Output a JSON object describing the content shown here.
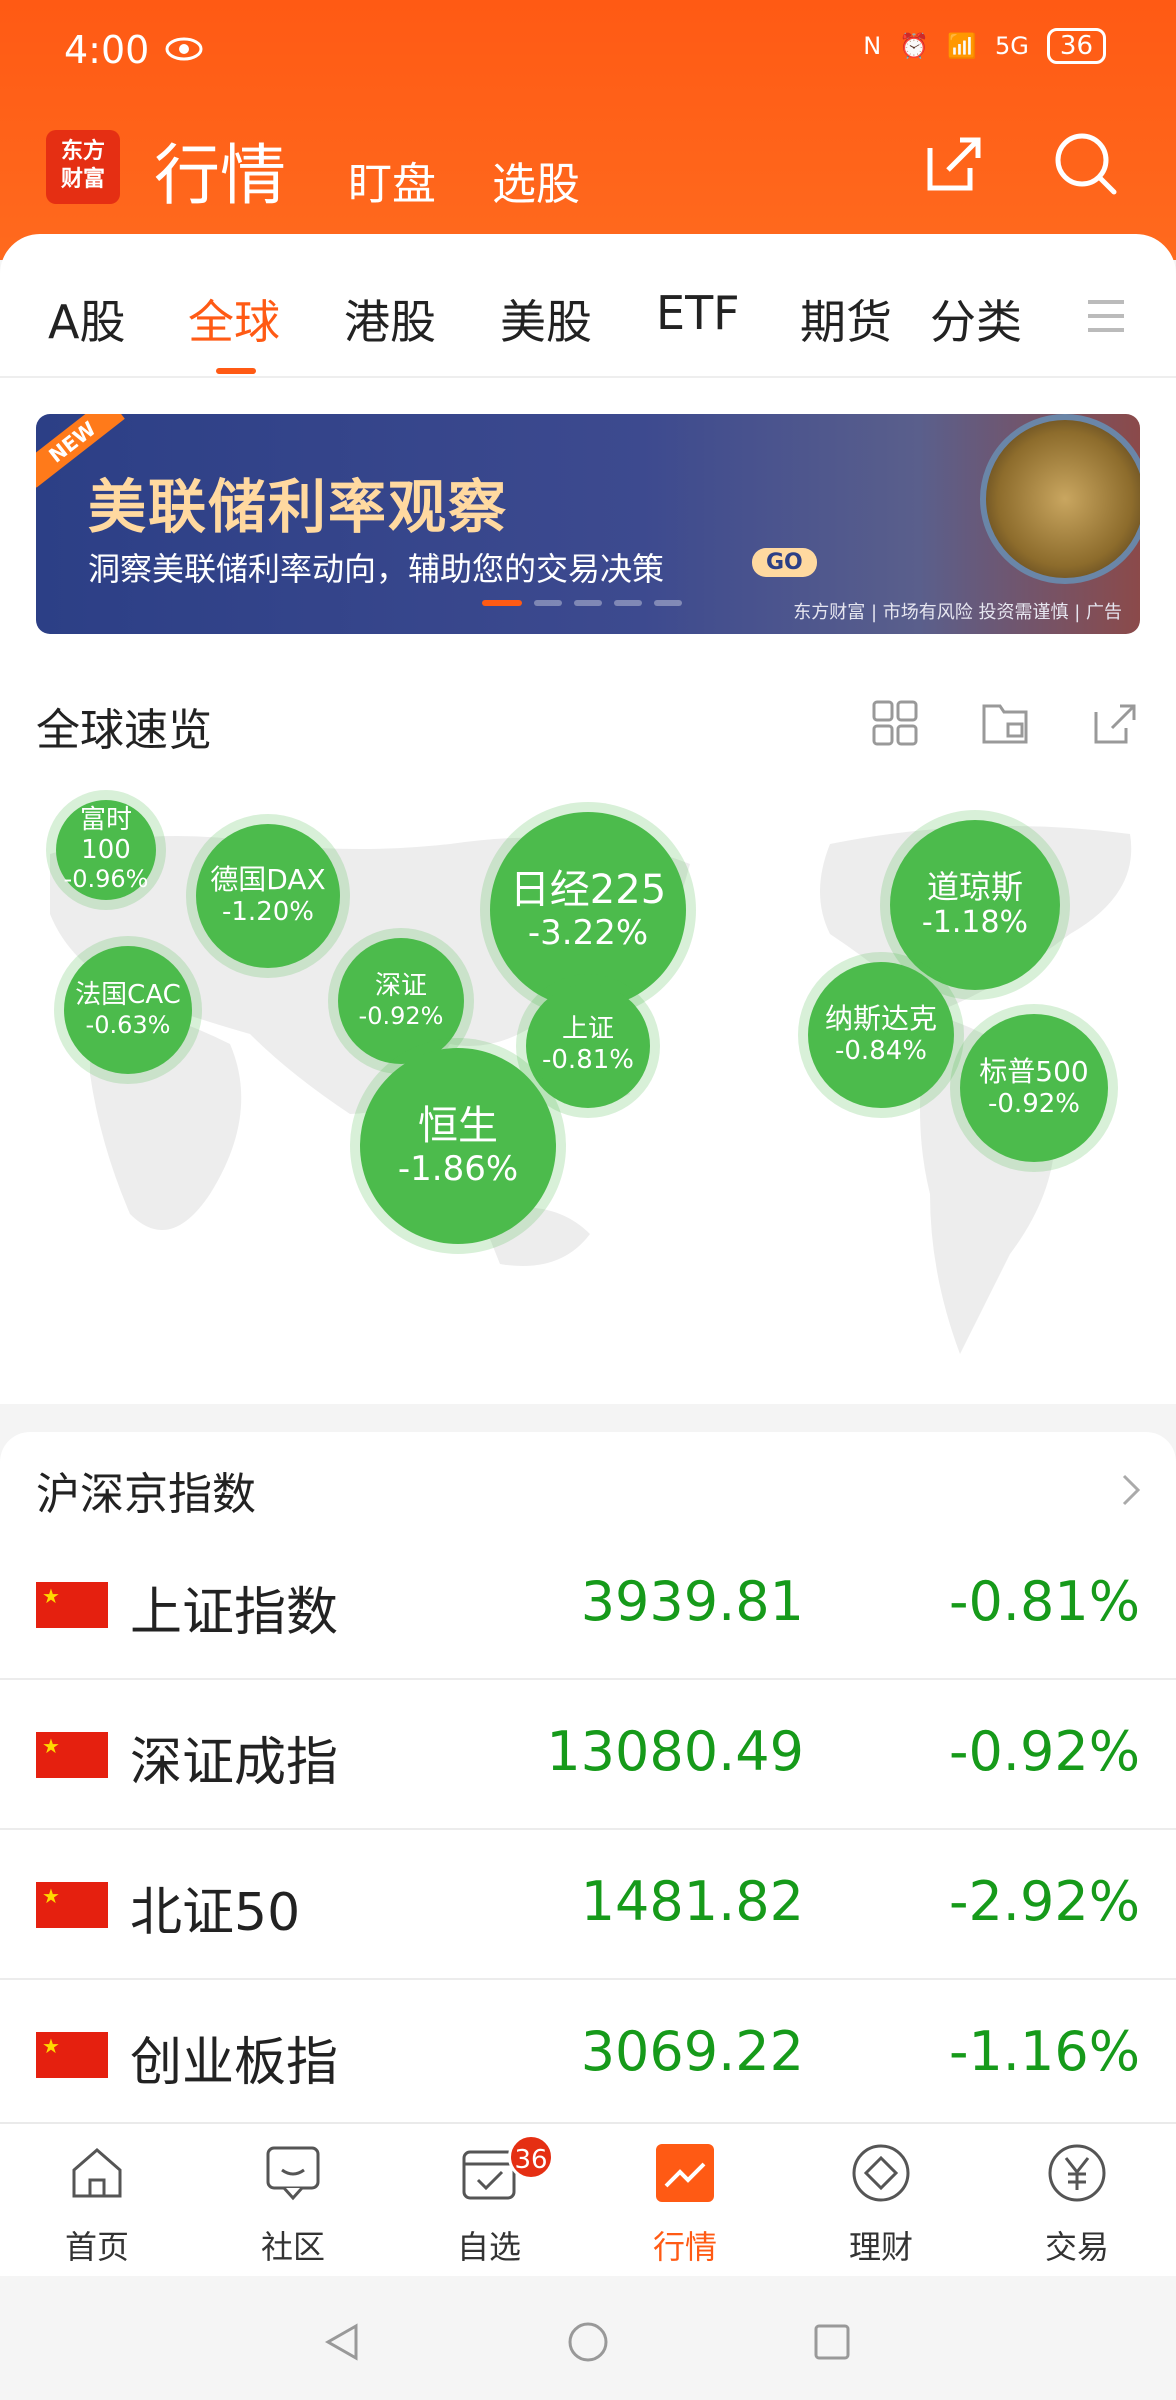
{
  "status_bar": {
    "time": "4:00",
    "battery": "36"
  },
  "header": {
    "logo_text": "东方财富",
    "title": "行情",
    "subnav": [
      "盯盘",
      "选股"
    ]
  },
  "tabs": [
    "A股",
    "全球",
    "港股",
    "美股",
    "ETF",
    "期货",
    "分类"
  ],
  "active_tab": 1,
  "banner": {
    "tag": "NEW",
    "title": "美联储利率观察",
    "subtitle": "洞察美联储利率动向，辅助您的交易决策",
    "go": "GO",
    "disclaimer": "东方财富 | 市场有风险 投资需谨慎 | 广告"
  },
  "overview": {
    "title": "全球速览",
    "bubbles": [
      {
        "name": "富时100",
        "pct": "-0.96%"
      },
      {
        "name": "德国DAX",
        "pct": "-1.20%"
      },
      {
        "name": "法国CAC",
        "pct": "-0.63%"
      },
      {
        "name": "深证",
        "pct": "-0.92%"
      },
      {
        "name": "日经225",
        "pct": "-3.22%"
      },
      {
        "name": "上证",
        "pct": "-0.81%"
      },
      {
        "name": "恒生",
        "pct": "-1.86%"
      },
      {
        "name": "道琼斯",
        "pct": "-1.18%"
      },
      {
        "name": "纳斯达克",
        "pct": "-0.84%"
      },
      {
        "name": "标普500",
        "pct": "-0.92%"
      }
    ]
  },
  "indices": {
    "title": "沪深京指数",
    "rows": [
      {
        "name": "上证指数",
        "value": "3939.81",
        "pct": "-0.81%"
      },
      {
        "name": "深证成指",
        "value": "13080.49",
        "pct": "-0.92%"
      },
      {
        "name": "北证50",
        "value": "1481.82",
        "pct": "-2.92%"
      },
      {
        "name": "创业板指",
        "value": "3069.22",
        "pct": "-1.16%"
      }
    ]
  },
  "bottom_nav": {
    "items": [
      {
        "label": "首页",
        "icon": "home-icon"
      },
      {
        "label": "社区",
        "icon": "chat-icon"
      },
      {
        "label": "自选",
        "icon": "calendar-check-icon",
        "badge": "36"
      },
      {
        "label": "行情",
        "icon": "chart-icon"
      },
      {
        "label": "理财",
        "icon": "diamond-icon"
      },
      {
        "label": "交易",
        "icon": "yen-icon"
      }
    ],
    "active_index": 3
  },
  "colors": {
    "accent": "#ff5a14",
    "down_green": "#169a1a",
    "bubble_green": "#4cbb4c"
  }
}
